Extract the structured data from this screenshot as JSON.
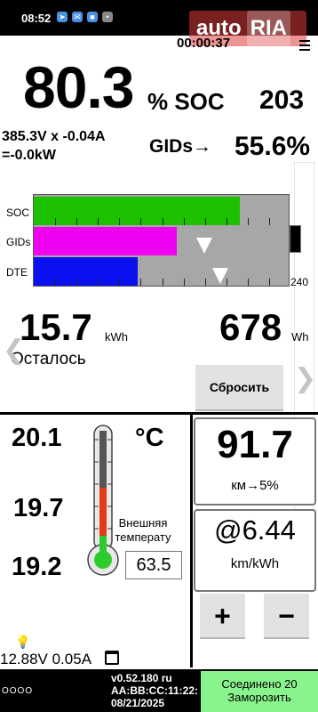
{
  "status_bar": {
    "time": "08:52",
    "icons": [
      "telegram-icon",
      "message-icon",
      "app-icon",
      "more-icon"
    ]
  },
  "watermark": {
    "text": "auto",
    "text2": "RIA"
  },
  "header": {
    "timer": "00:00:37"
  },
  "soc": {
    "value": "80.3",
    "unit": "% SOC",
    "gids": "203"
  },
  "power": {
    "line1": "385.3V x -0.04A",
    "line2": "=-0.0kW"
  },
  "gids": {
    "label": "GIDs→",
    "percent": "55.6%"
  },
  "bars": {
    "labels": [
      "SOC",
      "GIDs",
      "DTE"
    ],
    "max_label": "240",
    "colors": [
      "#1ec100",
      "#f000f0",
      "#0a10f0"
    ],
    "fill": [
      0.803,
      0.556,
      0.405
    ]
  },
  "remaining": {
    "kwh": "15.7",
    "kwh_unit": "kWh",
    "wh": "678",
    "wh_unit": "Wh",
    "label": "Осталось"
  },
  "reset_button": "Сбросить",
  "temperature": {
    "t1": "20.1",
    "t2": "19.7",
    "t3": "19.2",
    "unit": "°C",
    "external_label": "Внешняя температу",
    "external_value": "63.5"
  },
  "range": {
    "value": "91.7",
    "sub": "км→5%"
  },
  "consumption": {
    "value": "@6.44",
    "sub": "km/kWh"
  },
  "stepper": {
    "plus": "+",
    "minus": "−"
  },
  "bottom": {
    "voltage": "12.88V 0.05A"
  },
  "footer": {
    "dots": "OOOO",
    "version": "v0.52.180 ru",
    "mac": "AA:BB:CC:11:22:",
    "date": "08/21/2025",
    "connected_line1": "Соединено 20",
    "connected_line2": "Заморозить"
  }
}
